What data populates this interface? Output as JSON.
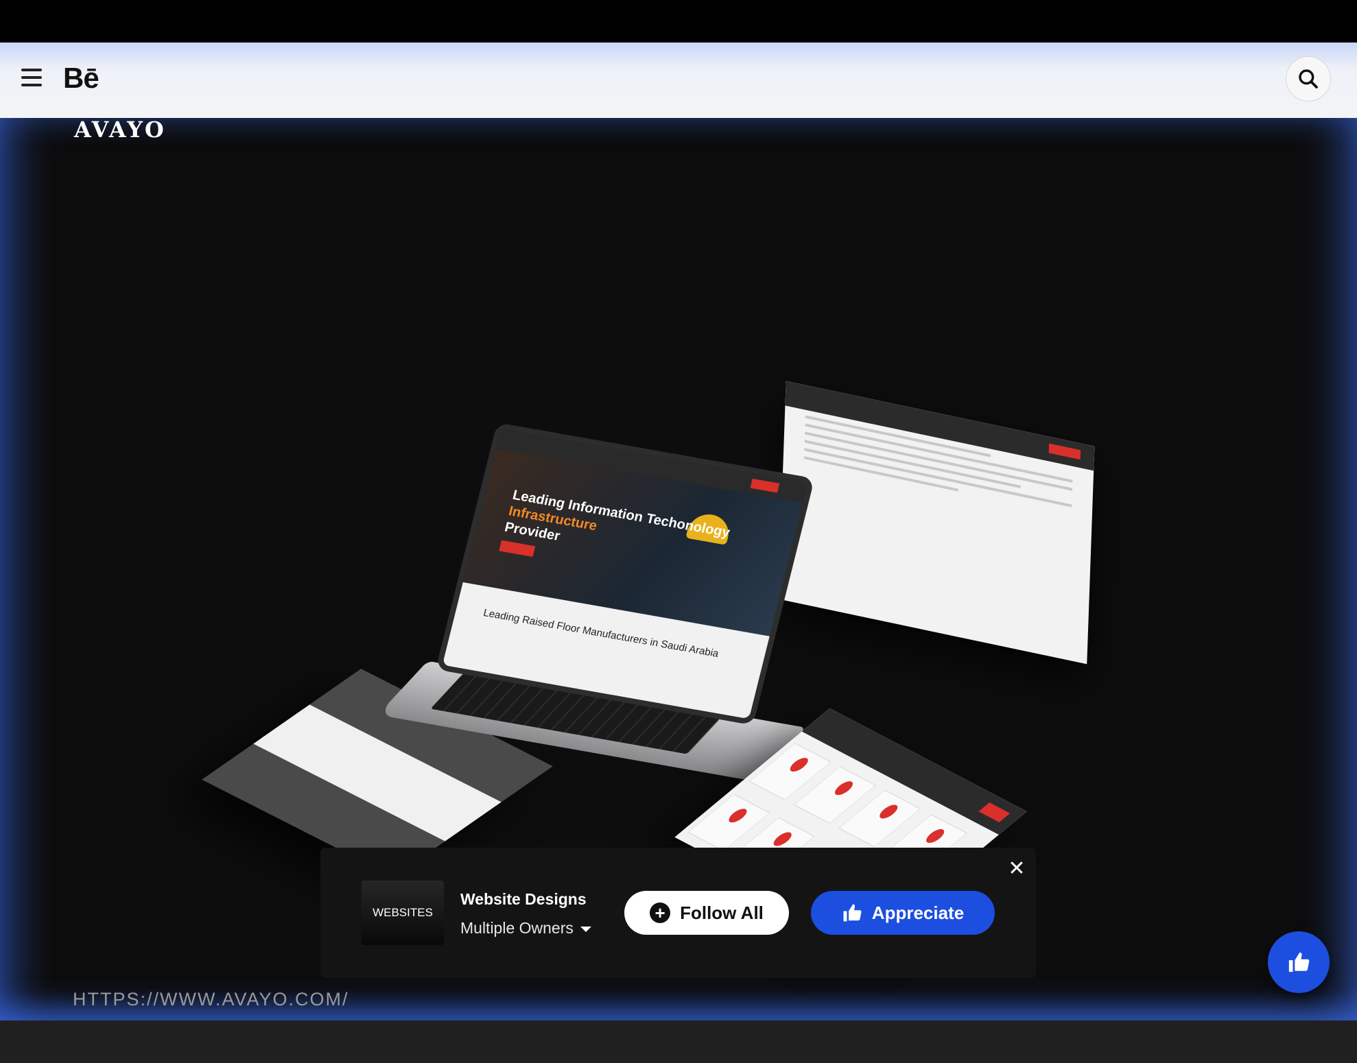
{
  "header": {
    "logo_text": "Bē",
    "menu_icon": "hamburger-icon",
    "search_icon": "search-icon"
  },
  "project": {
    "brand_logo": "AVAYO",
    "mockup_headline_1": "Leading Information Techonology",
    "mockup_headline_highlight": "Infrastructure",
    "mockup_headline_2": "Provider",
    "mockup_subheadline": "Leading Raised Floor Manufacturers in Saudi Arabia",
    "url_text": "HTTPS://WWW.AVAYO.COM/"
  },
  "follow_bar": {
    "thumbnail_label": "WEBSITES",
    "title": "Website Designs",
    "owners": "Multiple Owners",
    "follow_label": "Follow All",
    "appreciate_label": "Appreciate",
    "close_icon": "close-icon"
  },
  "colors": {
    "accent": "#1c4ee0",
    "brand_red": "#d9302c",
    "highlight_orange": "#f08a24"
  }
}
